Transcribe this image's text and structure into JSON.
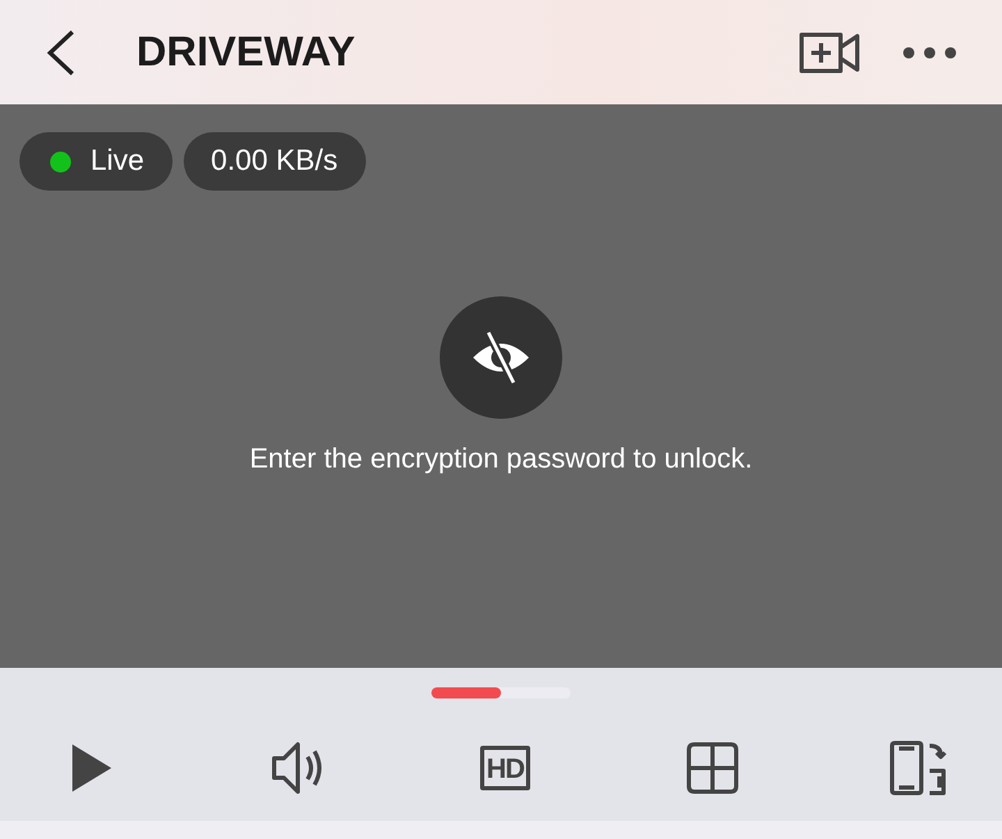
{
  "header": {
    "title": "DRIVEWAY"
  },
  "video": {
    "status": {
      "label": "Live",
      "color": "#12c21a"
    },
    "speed": "0.00 KB/s",
    "message": "Enter the encryption password to unlock."
  },
  "page_indicator": {
    "level": 0.5
  },
  "toolbar": [
    {
      "kind": "play"
    },
    {
      "kind": "sound"
    },
    {
      "kind": "hd",
      "label": "HD"
    },
    {
      "kind": "grid"
    },
    {
      "kind": "rotate"
    }
  ]
}
